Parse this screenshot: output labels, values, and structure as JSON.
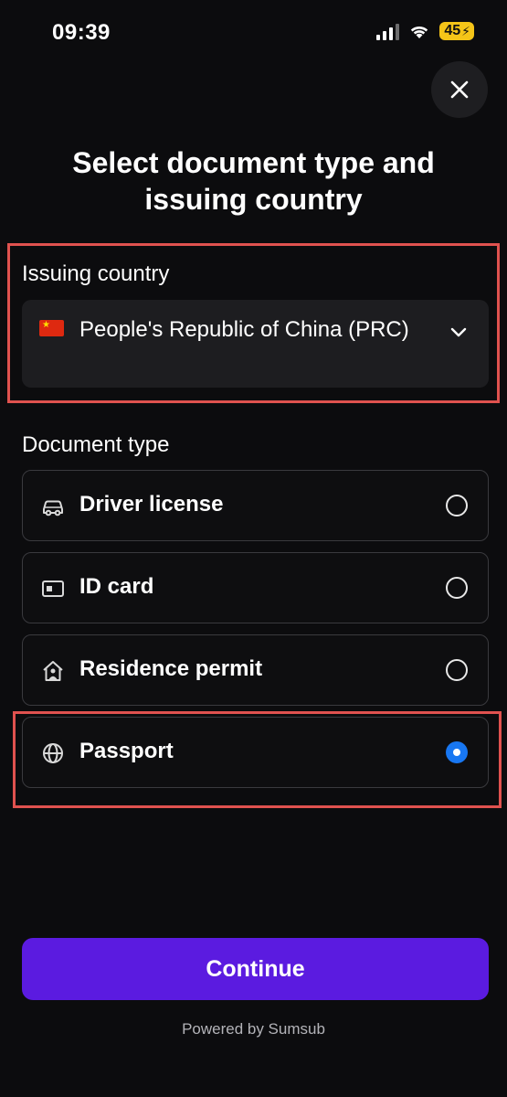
{
  "status_bar": {
    "time": "09:39",
    "battery": "45"
  },
  "title": "Select document type and issuing country",
  "issuing_country": {
    "label": "Issuing country",
    "flag_icon": "china-flag-icon",
    "value": "People's Republic of China (PRC)"
  },
  "document_type": {
    "label": "Document type",
    "options": [
      {
        "label": "Driver license",
        "icon": "car-icon",
        "selected": false
      },
      {
        "label": "ID card",
        "icon": "id-card-icon",
        "selected": false
      },
      {
        "label": "Residence permit",
        "icon": "house-person-icon",
        "selected": false
      },
      {
        "label": "Passport",
        "icon": "globe-icon",
        "selected": true
      }
    ]
  },
  "continue_label": "Continue",
  "powered_by": "Powered by Sumsub",
  "colors": {
    "background": "#0c0c0e",
    "accent": "#5b1be0",
    "radio_selected": "#1877f2",
    "highlight": "#e0524f"
  }
}
